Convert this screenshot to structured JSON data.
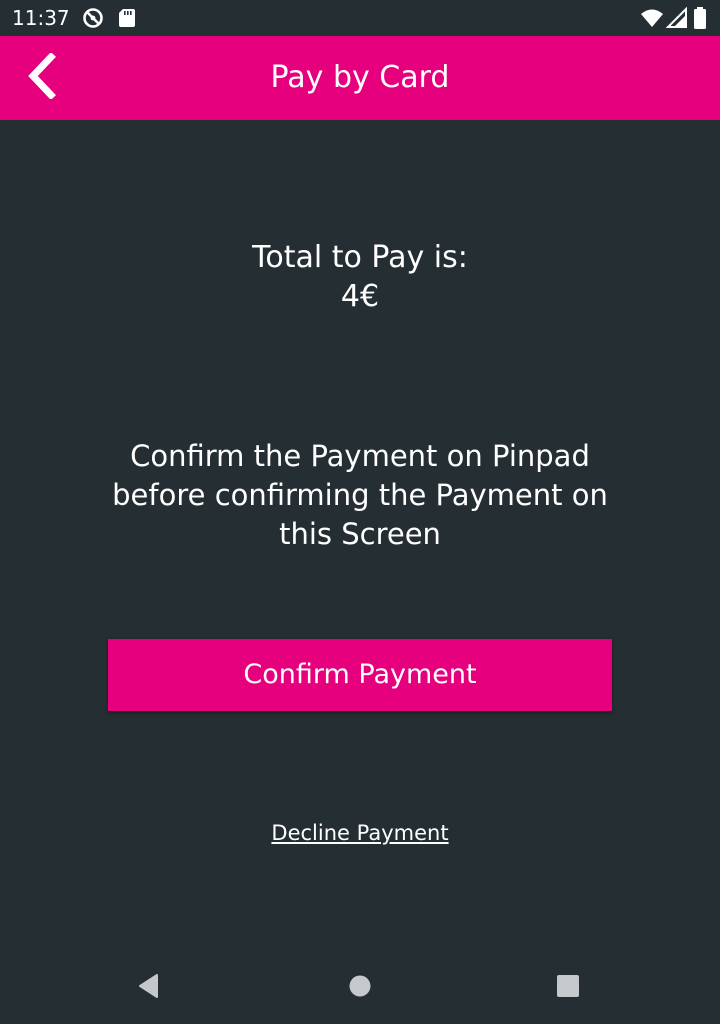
{
  "status_bar": {
    "time": "11:37",
    "icons": [
      "do-not-disturb-icon",
      "sd-card-icon",
      "wifi-icon",
      "cellular-signal-icon",
      "battery-icon"
    ]
  },
  "app_bar": {
    "title": "Pay by Card",
    "back_icon": "chevron-left-icon",
    "color": "#e6007e"
  },
  "payment": {
    "total_label": "Total to Pay is:",
    "total_amount": "4€",
    "instruction": "Confirm the Payment on Pinpad before confirming the Payment on this Screen",
    "confirm_label": "Confirm Payment",
    "decline_label": "Decline Payment"
  },
  "nav_bar": {
    "icons": [
      "back-triangle-icon",
      "home-circle-icon",
      "recents-square-icon"
    ]
  },
  "colors": {
    "background": "#252e33",
    "accent": "#e6007e",
    "text": "#ffffff"
  }
}
